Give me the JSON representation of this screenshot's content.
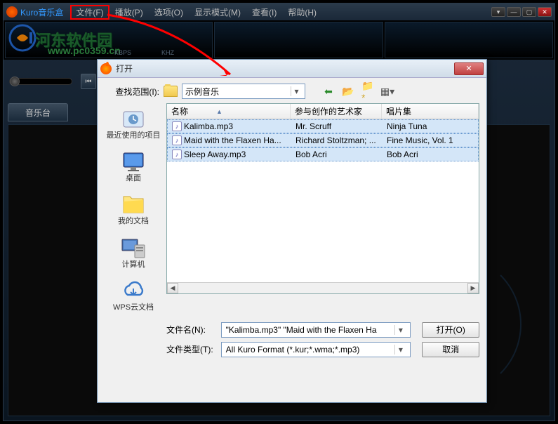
{
  "app": {
    "title": "Kuro音乐盒",
    "menus": [
      "文件(F)",
      "播放(P)",
      "选项(O)",
      "显示模式(M)",
      "查看(I)",
      "帮助(H)"
    ],
    "highlighted_menu_index": 0
  },
  "watermark": {
    "text": "河东软件园",
    "url": "www.pc0359.cn"
  },
  "display": {
    "kbps": "KBPS",
    "khz": "KHZ"
  },
  "tabs": [
    "音乐台"
  ],
  "dialog": {
    "title": "打开",
    "lookin_label": "查找范围(I):",
    "lookin_value": "示例音乐",
    "columns": [
      "名称",
      "参与创作的艺术家",
      "唱片集"
    ],
    "places": [
      {
        "label": "最近使用的项目",
        "icon": "🗂"
      },
      {
        "label": "桌面",
        "icon": "🖥"
      },
      {
        "label": "我的文档",
        "icon": "📁"
      },
      {
        "label": "计算机",
        "icon": "💻"
      },
      {
        "label": "WPS云文档",
        "icon": "☁"
      }
    ],
    "files": [
      {
        "name": "Kalimba.mp3",
        "artist": "Mr. Scruff",
        "album": "Ninja Tuna",
        "selected": true
      },
      {
        "name": "Maid with the Flaxen Ha...",
        "artist": "Richard Stoltzman; ...",
        "album": "Fine Music, Vol. 1",
        "selected": true
      },
      {
        "name": "Sleep Away.mp3",
        "artist": "Bob Acri",
        "album": "Bob Acri",
        "selected": true
      }
    ],
    "filename_label": "文件名(N):",
    "filename_value": "\"Kalimba.mp3\" \"Maid with the Flaxen Ha",
    "filetype_label": "文件类型(T):",
    "filetype_value": "All Kuro Format (*.kur;*.wma;*.mp3)",
    "open_btn": "打开(O)",
    "cancel_btn": "取消"
  }
}
